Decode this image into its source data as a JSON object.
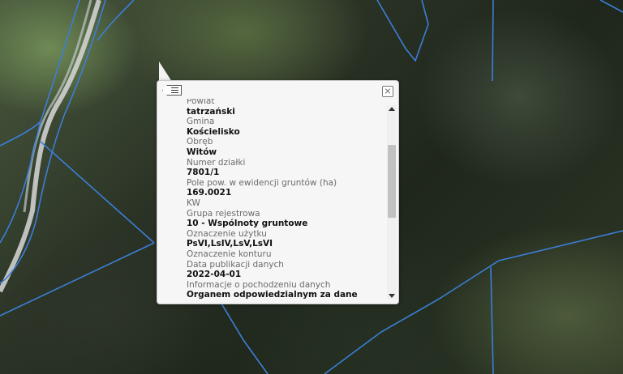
{
  "map": {
    "type": "aerial-orthophoto",
    "parcel_boundary_color": "#3b7fd6",
    "road_color": "#d8d8d8"
  },
  "popup": {
    "list_icon": "list-icon",
    "close_icon": "close-icon",
    "fields": [
      {
        "label": "Powiat",
        "value": "tatrzański"
      },
      {
        "label": "Gmina",
        "value": "Kościelisko"
      },
      {
        "label": "Obręb",
        "value": "Witów"
      },
      {
        "label": "Numer działki",
        "value": "7801/1"
      },
      {
        "label": "Pole pow. w ewidencji gruntów (ha)",
        "value": "169.0021"
      },
      {
        "label": "KW",
        "value": ""
      },
      {
        "label": "Grupa rejestrowa",
        "value": "10 - Wspólnoty gruntowe"
      },
      {
        "label": "Oznaczenie użytku",
        "value": "PsVI,LsIV,LsV,LsVI"
      },
      {
        "label": "Oznaczenie konturu",
        "value": ""
      },
      {
        "label": "Data publikacji danych",
        "value": "2022-04-01"
      },
      {
        "label": "Informacje o pochodzeniu danych",
        "value": "Organem odpowiedzialnym za dane"
      }
    ]
  }
}
